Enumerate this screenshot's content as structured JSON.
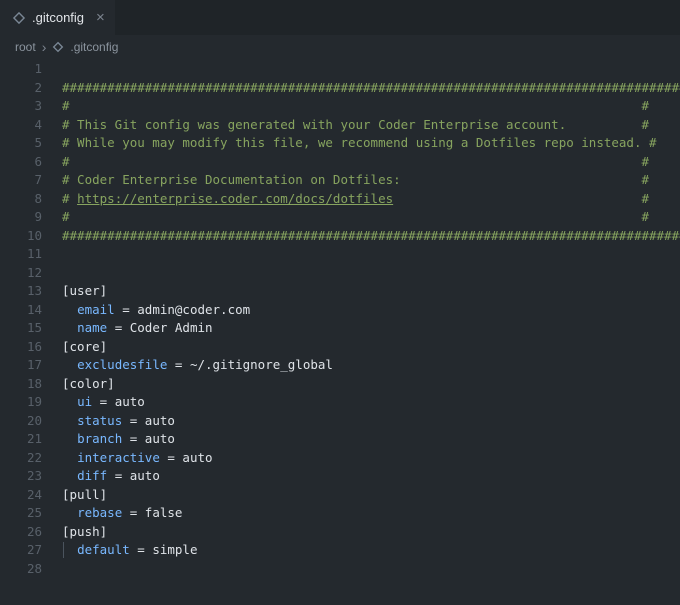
{
  "colors": {
    "editor_bg": "#24292e",
    "tabbar_bg": "#1f2428",
    "tab_fg": "#e1e4e8",
    "breadcrumb_fg": "#8b949e",
    "muted_fg": "#7d8590",
    "icon": "#7a8795",
    "line_number": "#586069",
    "comment": "#87a45f",
    "key": "#79b8ff",
    "plain": "#dfe3e8",
    "guide": "#4b545e"
  },
  "tab": {
    "title": ".gitconfig",
    "close_label": "×",
    "icon": "config-diamond-icon"
  },
  "breadcrumb": {
    "root": "root",
    "separator": "›",
    "file": ".gitconfig"
  },
  "editor": {
    "lines": [
      {
        "n": "1",
        "segs": []
      },
      {
        "n": "2",
        "segs": [
          {
            "c": "comment",
            "t": "#",
            "rep": 85
          }
        ]
      },
      {
        "n": "3",
        "segs": [
          {
            "c": "comment",
            "t": "#"
          },
          {
            "c": "space",
            "nsp": 76
          },
          {
            "c": "comment",
            "t": "#"
          }
        ]
      },
      {
        "n": "4",
        "segs": [
          {
            "c": "comment",
            "t": "# This Git config was generated with your Coder Enterprise account."
          },
          {
            "c": "space",
            "nsp": 10
          },
          {
            "c": "comment",
            "t": "#"
          }
        ]
      },
      {
        "n": "5",
        "segs": [
          {
            "c": "comment",
            "t": "# While you may modify this file, we recommend using a Dotfiles repo instead. #"
          }
        ]
      },
      {
        "n": "6",
        "segs": [
          {
            "c": "comment",
            "t": "#"
          },
          {
            "c": "space",
            "nsp": 76
          },
          {
            "c": "comment",
            "t": "#"
          }
        ]
      },
      {
        "n": "7",
        "segs": [
          {
            "c": "comment",
            "t": "# Coder Enterprise Documentation on Dotfiles:"
          },
          {
            "c": "space",
            "nsp": 32
          },
          {
            "c": "comment",
            "t": "#"
          }
        ]
      },
      {
        "n": "8",
        "segs": [
          {
            "c": "comment",
            "t": "# "
          },
          {
            "c": "link",
            "t": "https://enterprise.coder.com/docs/dotfiles"
          },
          {
            "c": "space",
            "nsp": 33
          },
          {
            "c": "comment",
            "t": "#"
          }
        ]
      },
      {
        "n": "9",
        "segs": [
          {
            "c": "comment",
            "t": "#"
          },
          {
            "c": "space",
            "nsp": 76
          },
          {
            "c": "comment",
            "t": "#"
          }
        ]
      },
      {
        "n": "10",
        "segs": [
          {
            "c": "comment",
            "t": "#",
            "rep": 85
          }
        ]
      },
      {
        "n": "11",
        "segs": []
      },
      {
        "n": "12",
        "segs": []
      },
      {
        "n": "13",
        "segs": [
          {
            "c": "section",
            "t": "[user]"
          }
        ]
      },
      {
        "n": "14",
        "segs": [
          {
            "c": "space",
            "nsp": 2
          },
          {
            "c": "key",
            "t": "email"
          },
          {
            "c": "plain",
            "t": " = admin@coder.com"
          }
        ]
      },
      {
        "n": "15",
        "segs": [
          {
            "c": "space",
            "nsp": 2
          },
          {
            "c": "key",
            "t": "name"
          },
          {
            "c": "plain",
            "t": " = Coder Admin"
          }
        ]
      },
      {
        "n": "16",
        "segs": [
          {
            "c": "section",
            "t": "[core]"
          }
        ]
      },
      {
        "n": "17",
        "segs": [
          {
            "c": "space",
            "nsp": 2
          },
          {
            "c": "key",
            "t": "excludesfile"
          },
          {
            "c": "plain",
            "t": " = ~/.gitignore_global"
          }
        ]
      },
      {
        "n": "18",
        "segs": [
          {
            "c": "section",
            "t": "[color]"
          }
        ]
      },
      {
        "n": "19",
        "segs": [
          {
            "c": "space",
            "nsp": 2
          },
          {
            "c": "key",
            "t": "ui"
          },
          {
            "c": "plain",
            "t": " = auto"
          }
        ]
      },
      {
        "n": "20",
        "segs": [
          {
            "c": "space",
            "nsp": 2
          },
          {
            "c": "key",
            "t": "status"
          },
          {
            "c": "plain",
            "t": " = auto"
          }
        ]
      },
      {
        "n": "21",
        "segs": [
          {
            "c": "space",
            "nsp": 2
          },
          {
            "c": "key",
            "t": "branch"
          },
          {
            "c": "plain",
            "t": " = auto"
          }
        ]
      },
      {
        "n": "22",
        "segs": [
          {
            "c": "space",
            "nsp": 2
          },
          {
            "c": "key",
            "t": "interactive"
          },
          {
            "c": "plain",
            "t": " = auto"
          }
        ]
      },
      {
        "n": "23",
        "segs": [
          {
            "c": "space",
            "nsp": 2
          },
          {
            "c": "key",
            "t": "diff"
          },
          {
            "c": "plain",
            "t": " = auto"
          }
        ]
      },
      {
        "n": "24",
        "segs": [
          {
            "c": "section",
            "t": "[pull]"
          }
        ]
      },
      {
        "n": "25",
        "segs": [
          {
            "c": "space",
            "nsp": 2
          },
          {
            "c": "key",
            "t": "rebase"
          },
          {
            "c": "plain",
            "t": " = false"
          }
        ]
      },
      {
        "n": "26",
        "segs": [
          {
            "c": "section",
            "t": "[push]"
          }
        ]
      },
      {
        "n": "27",
        "cursor": true,
        "segs": [
          {
            "c": "space",
            "nsp": 2
          },
          {
            "c": "key",
            "t": "default"
          },
          {
            "c": "plain",
            "t": " = simple"
          }
        ]
      },
      {
        "n": "28",
        "segs": []
      }
    ]
  }
}
